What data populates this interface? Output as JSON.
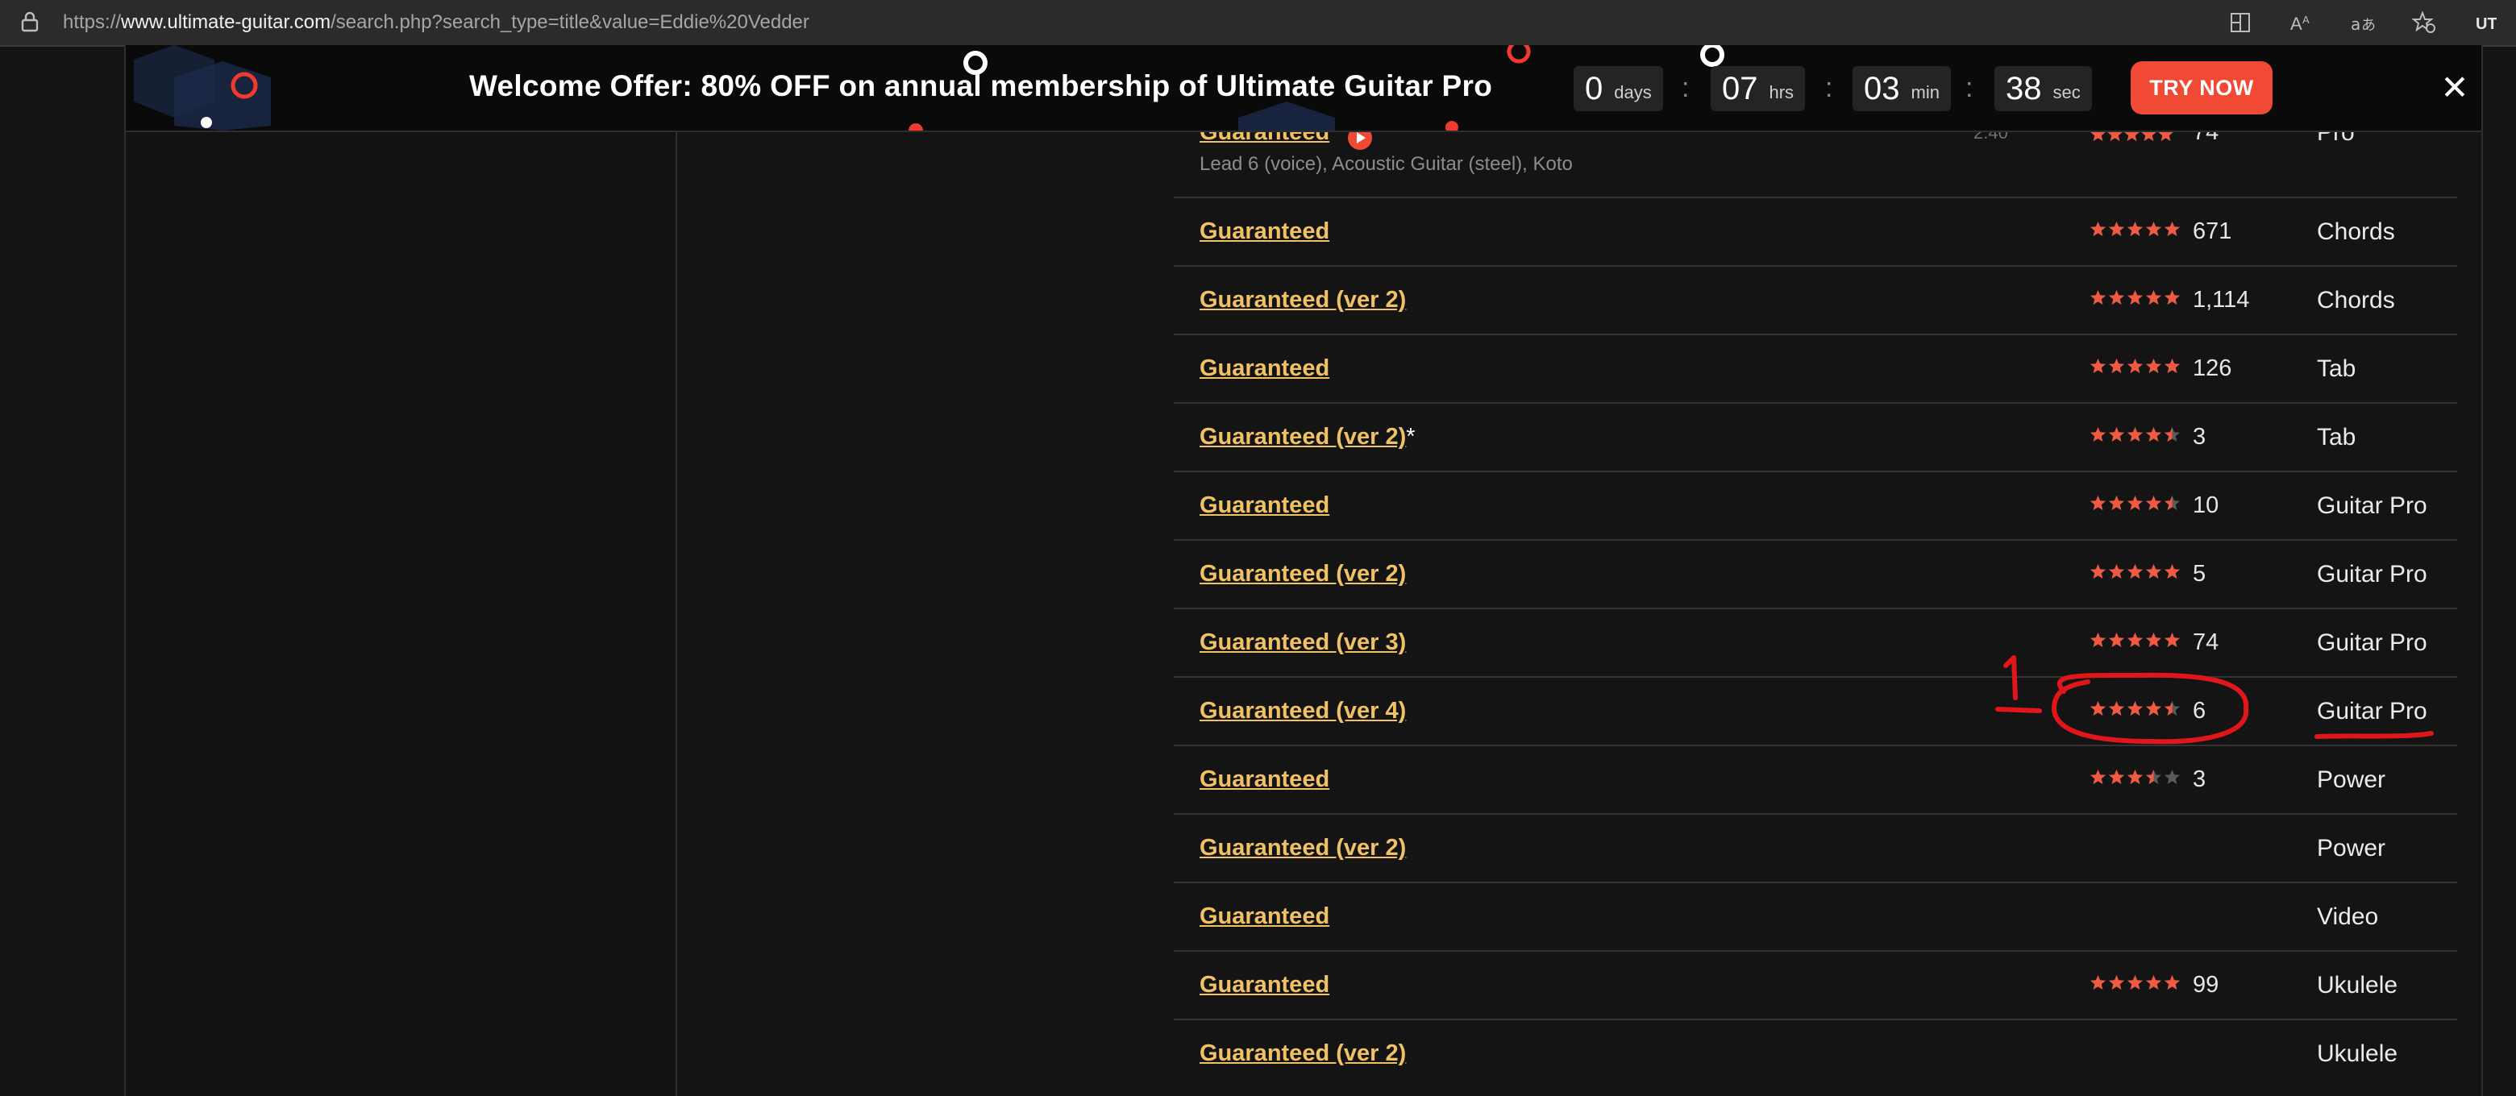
{
  "browser": {
    "url_prefix": "https://",
    "url_domain": "www.ultimate-guitar.com",
    "url_rest": "/search.php?search_type=title&value=Eddie%20Vedder",
    "icons": [
      "lock-icon",
      "split-screen-icon",
      "read-aloud-icon",
      "translate-icon",
      "favorite-icon",
      "profile-icon"
    ]
  },
  "banner": {
    "title": "Welcome Offer: 80% OFF on annual membership of Ultimate Guitar Pro",
    "countdown": [
      {
        "value": "0",
        "unit": "days"
      },
      {
        "value": "07",
        "unit": "hrs"
      },
      {
        "value": "03",
        "unit": "min"
      },
      {
        "value": "38",
        "unit": "sec"
      }
    ],
    "separator": ":",
    "cta": "TRY NOW",
    "close": "✕"
  },
  "partial_row": {
    "title": "Guaranteed",
    "version_hint": "2.40",
    "rating": 5,
    "votes": "74",
    "type": "Pro",
    "instruments": "Lead 6 (voice), Acoustic Guitar (steel), Koto"
  },
  "results": [
    {
      "title": "Guaranteed",
      "asterisk": "",
      "rating": 5,
      "votes": "671",
      "type": "Chords"
    },
    {
      "title": "Guaranteed (ver 2)",
      "asterisk": "",
      "rating": 5,
      "votes": "1,114",
      "type": "Chords"
    },
    {
      "title": "Guaranteed",
      "asterisk": "",
      "rating": 5,
      "votes": "126",
      "type": "Tab"
    },
    {
      "title": "Guaranteed (ver 2)",
      "asterisk": "*",
      "rating": 4.5,
      "votes": "3",
      "type": "Tab"
    },
    {
      "title": "Guaranteed",
      "asterisk": "",
      "rating": 4.5,
      "votes": "10",
      "type": "Guitar Pro"
    },
    {
      "title": "Guaranteed (ver 2)",
      "asterisk": "",
      "rating": 5,
      "votes": "5",
      "type": "Guitar Pro"
    },
    {
      "title": "Guaranteed (ver 3)",
      "asterisk": "",
      "rating": 5,
      "votes": "74",
      "type": "Guitar Pro"
    },
    {
      "title": "Guaranteed (ver 4)",
      "asterisk": "",
      "rating": 4.5,
      "votes": "6",
      "type": "Guitar Pro"
    },
    {
      "title": "Guaranteed",
      "asterisk": "",
      "rating": 3.5,
      "votes": "3",
      "type": "Power"
    },
    {
      "title": "Guaranteed (ver 2)",
      "asterisk": "",
      "rating": null,
      "votes": "",
      "type": "Power"
    },
    {
      "title": "Guaranteed",
      "asterisk": "",
      "rating": null,
      "votes": "",
      "type": "Video"
    },
    {
      "title": "Guaranteed",
      "asterisk": "",
      "rating": 5,
      "votes": "99",
      "type": "Ukulele"
    },
    {
      "title": "Guaranteed (ver 2)",
      "asterisk": "",
      "rating": null,
      "votes": "",
      "type": "Ukulele"
    }
  ],
  "annotation": {
    "label": "1",
    "color": "#e0161b"
  },
  "colors": {
    "link": "#f1c265",
    "star": "#f05a43",
    "star_empty": "#5a5a5a",
    "cta": "#f04a35",
    "background": "#141414"
  }
}
